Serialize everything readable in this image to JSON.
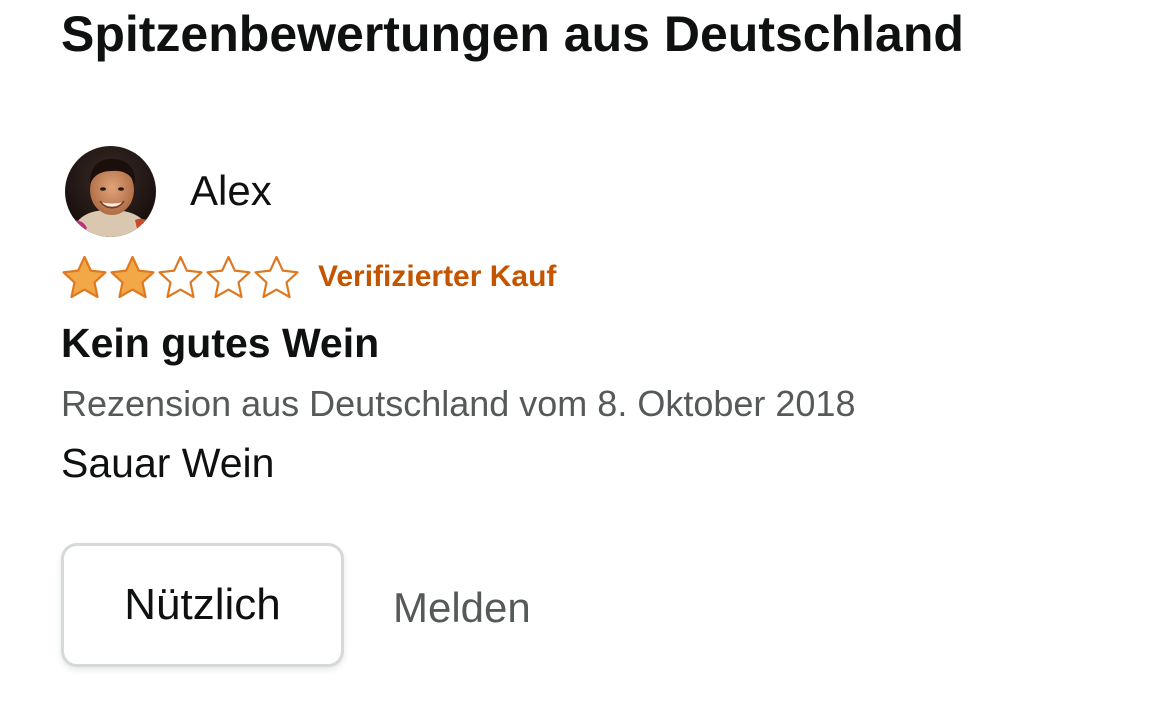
{
  "section": {
    "title": "Spitzenbewertungen aus Deutschland"
  },
  "review": {
    "author": {
      "name": "Alex",
      "avatar_icon": "profile-photo"
    },
    "rating": {
      "value": 2,
      "max": 5,
      "filled_color": "#f3a847",
      "outline_color": "#de7921",
      "icon": "star-icon"
    },
    "verified_label": "Verifizierter Kauf",
    "verified_color": "#c45500",
    "title": "Kein gutes Wein",
    "date_line": "Rezension aus Deutschland vom 8. Oktober 2018",
    "body": "Sauar Wein",
    "actions": {
      "helpful_label": "Nützlich",
      "report_label": "Melden"
    }
  }
}
